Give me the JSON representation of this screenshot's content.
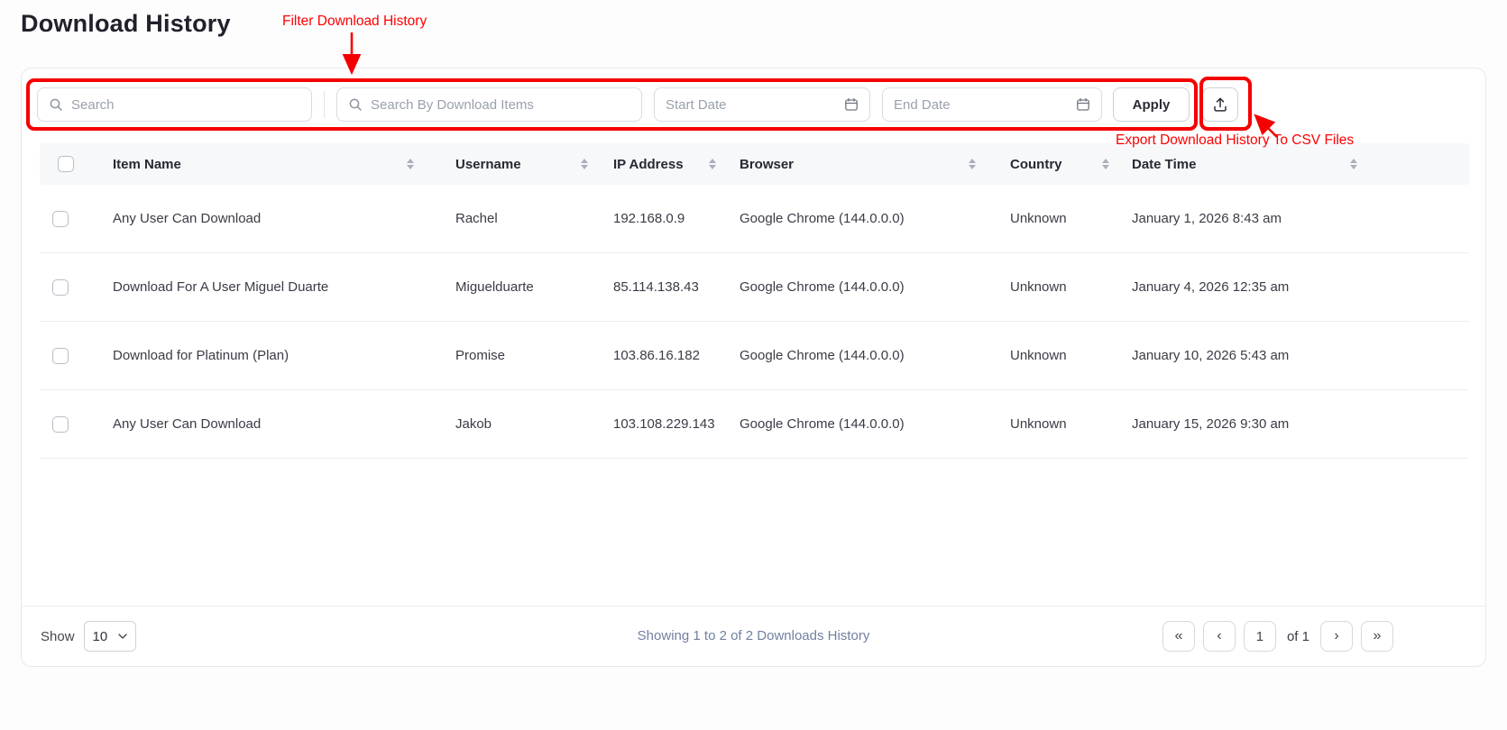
{
  "page_title": "Download History",
  "annotations": {
    "filter_label": "Filter Download History",
    "export_label": "Export Download History To CSV Files",
    "accent_red": "#f40000"
  },
  "filters": {
    "search_placeholder": "Search",
    "items_placeholder": "Search By Download Items",
    "start_date_placeholder": "Start Date",
    "end_date_placeholder": "End Date",
    "apply_label": "Apply"
  },
  "table": {
    "columns": {
      "item": "Item Name",
      "username": "Username",
      "ip": "IP Address",
      "browser": "Browser",
      "country": "Country",
      "datetime": "Date Time"
    },
    "rows": [
      {
        "item": "Any User Can Download",
        "username": "Rachel",
        "ip": "192.168.0.9",
        "browser": "Google Chrome (144.0.0.0)",
        "country": "Unknown",
        "datetime": "January 1, 2026 8:43 am"
      },
      {
        "item": "Download For A User Miguel Duarte",
        "username": "Miguelduarte",
        "ip": "85.114.138.43",
        "browser": "Google Chrome (144.0.0.0)",
        "country": "Unknown",
        "datetime": "January 4, 2026 12:35 am"
      },
      {
        "item": "Download for Platinum (Plan)",
        "username": "Promise",
        "ip": "103.86.16.182",
        "browser": "Google Chrome (144.0.0.0)",
        "country": "Unknown",
        "datetime": "January 10, 2026 5:43 am"
      },
      {
        "item": "Any User Can Download",
        "username": "Jakob",
        "ip": "103.108.229.143",
        "browser": "Google Chrome (144.0.0.0)",
        "country": "Unknown",
        "datetime": "January 15, 2026 9:30 am"
      }
    ]
  },
  "footer": {
    "show_label": "Show",
    "per_page": "10",
    "summary": "Showing 1 to 2 of 2 Downloads History",
    "pagination": {
      "first": "«",
      "prev": "‹",
      "page": "1",
      "of": "of 1",
      "next": "›",
      "last": "»"
    }
  }
}
